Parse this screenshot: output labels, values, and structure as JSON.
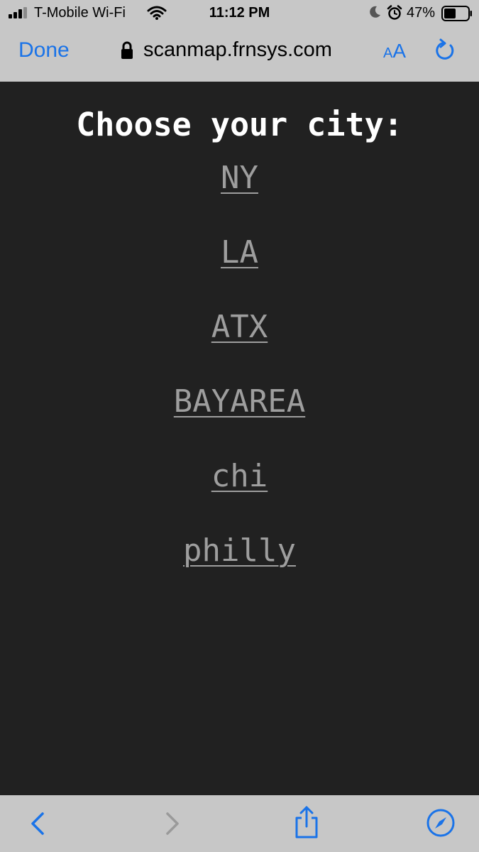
{
  "status_bar": {
    "carrier": "T-Mobile Wi-Fi",
    "time": "11:12 PM",
    "battery_percent": "47%",
    "icons": [
      "signal-icon",
      "wifi-icon",
      "moon-icon",
      "alarm-icon",
      "battery-icon"
    ]
  },
  "browser": {
    "done_label": "Done",
    "url": "scanmap.frnsys.com",
    "aa_small": "A",
    "aa_big": "A",
    "accent_color": "#1a73e8",
    "icons": [
      "lock-icon",
      "reload-icon",
      "back-icon",
      "forward-icon",
      "share-icon",
      "compass-icon"
    ]
  },
  "page": {
    "heading": "Choose your city:",
    "cities": [
      "NY",
      "LA",
      "ATX",
      "BAYAREA",
      "chi",
      "philly"
    ],
    "background_color": "#212121",
    "link_color": "#9e9e9e"
  }
}
